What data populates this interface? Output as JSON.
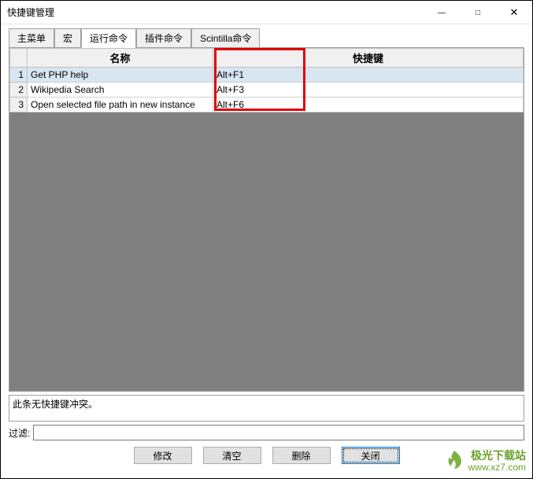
{
  "window": {
    "title": "快捷键管理"
  },
  "tabs": {
    "t0": "主菜单",
    "t1": "宏",
    "t2": "运行命令",
    "t3": "插件命令",
    "t4": "Scintilla命令"
  },
  "table": {
    "headers": {
      "num": "",
      "name": "名称",
      "shortcut": "快捷键"
    },
    "rows": [
      {
        "n": "1",
        "name": "Get PHP help",
        "shortcut": "Alt+F1"
      },
      {
        "n": "2",
        "name": "Wikipedia Search",
        "shortcut": "Alt+F3"
      },
      {
        "n": "3",
        "name": "Open selected file path in new instance",
        "shortcut": "Alt+F6"
      }
    ]
  },
  "status": {
    "text": "此条无快捷键冲突。"
  },
  "filter": {
    "label": "过滤:",
    "value": ""
  },
  "buttons": {
    "modify": "修改",
    "clear": "清空",
    "delete": "删除",
    "close": "关闭"
  },
  "watermark": {
    "cn": "极光下载站",
    "url": "www.xz7.com"
  }
}
